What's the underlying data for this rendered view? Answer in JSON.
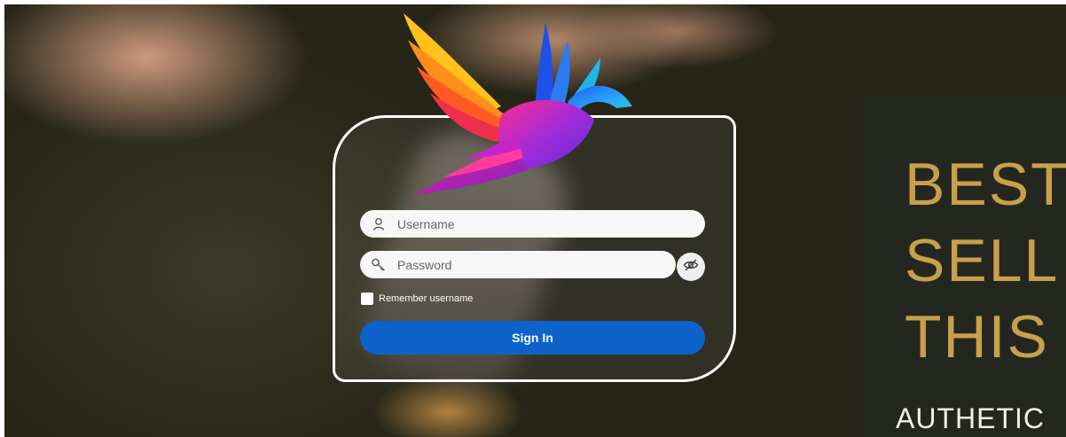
{
  "login": {
    "username_placeholder": "Username",
    "password_placeholder": "Password",
    "remember_label": "Remember username",
    "signin_label": "Sign In",
    "remember_checked": false
  },
  "promo": {
    "line1": "BEST",
    "line2": "SELL",
    "line3": "THIS",
    "subline": "AUTHETIC"
  },
  "icons": {
    "username": "user-icon",
    "password": "key-icon",
    "toggle_password": "eye-slash-icon",
    "logo": "hummingbird-logo"
  },
  "colors": {
    "signin_button": "#0d63c9",
    "promo_gold": "#c8a04a",
    "promo_panel": "#232720"
  }
}
